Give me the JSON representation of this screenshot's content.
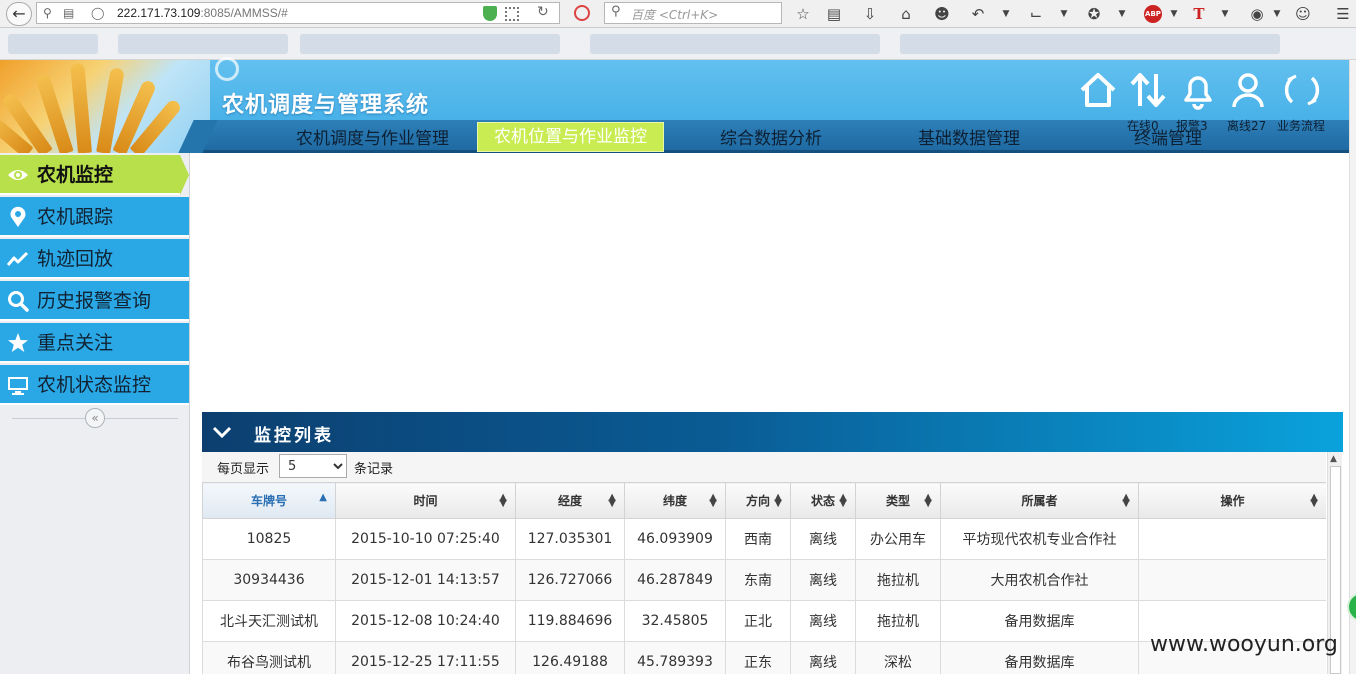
{
  "browser": {
    "url_main": "222.171.73.109",
    "url_rest": ":8085/AMMSS/#",
    "search_placeholder": "百度 <Ctrl+K>"
  },
  "header": {
    "app_title": "农机调度与管理系统",
    "nav": [
      {
        "label": "农机调度与作业管理",
        "active": false
      },
      {
        "label": "农机位置与作业监控",
        "active": true
      },
      {
        "label": "综合数据分析",
        "active": false
      },
      {
        "label": "基础数据管理",
        "active": false
      },
      {
        "label": "终端管理",
        "active": false
      }
    ],
    "stats": {
      "online": "在线0",
      "alarm": "报警3",
      "offline": "离线27",
      "workflow": "业务流程"
    }
  },
  "sidebar": {
    "items": [
      {
        "label": "农机监控",
        "icon": "eye-icon",
        "active": true
      },
      {
        "label": "农机跟踪",
        "icon": "location-pin-icon",
        "active": false
      },
      {
        "label": "轨迹回放",
        "icon": "trend-line-icon",
        "active": false
      },
      {
        "label": "历史报警查询",
        "icon": "search-icon",
        "active": false
      },
      {
        "label": "重点关注",
        "icon": "star-icon",
        "active": false
      },
      {
        "label": "农机状态监控",
        "icon": "monitor-icon",
        "active": false
      }
    ],
    "collapse_glyph": "«"
  },
  "panel": {
    "title": "监控列表",
    "page_size_label": "每页显示",
    "page_size_value": "5",
    "records_label": "条记录"
  },
  "table": {
    "columns": [
      "车牌号",
      "时间",
      "经度",
      "纬度",
      "方向",
      "状态",
      "类型",
      "所属者",
      "操作"
    ],
    "rows": [
      [
        "10825",
        "2015-10-10 07:25:40",
        "127.035301",
        "46.093909",
        "西南",
        "离线",
        "办公用车",
        "平坊现代农机专业合作社",
        ""
      ],
      [
        "30934436",
        "2015-12-01 14:13:57",
        "126.727066",
        "46.287849",
        "东南",
        "离线",
        "拖拉机",
        "大用农机合作社",
        ""
      ],
      [
        "北斗天汇测试机",
        "2015-12-08 10:24:40",
        "119.884696",
        "32.45805",
        "正北",
        "离线",
        "拖拉机",
        "备用数据库",
        ""
      ],
      [
        "布谷鸟测试机",
        "2015-12-25 17:11:55",
        "126.49188",
        "45.789393",
        "正东",
        "离线",
        "深松",
        "备用数据库",
        ""
      ]
    ]
  },
  "watermark": "www.wooyun.org",
  "colors": {
    "header_blue": "#3aa9e4",
    "nav_dark": "#1f6aa3",
    "active_green": "#b8e04a",
    "sidebar_blue": "#2aa8e6"
  }
}
